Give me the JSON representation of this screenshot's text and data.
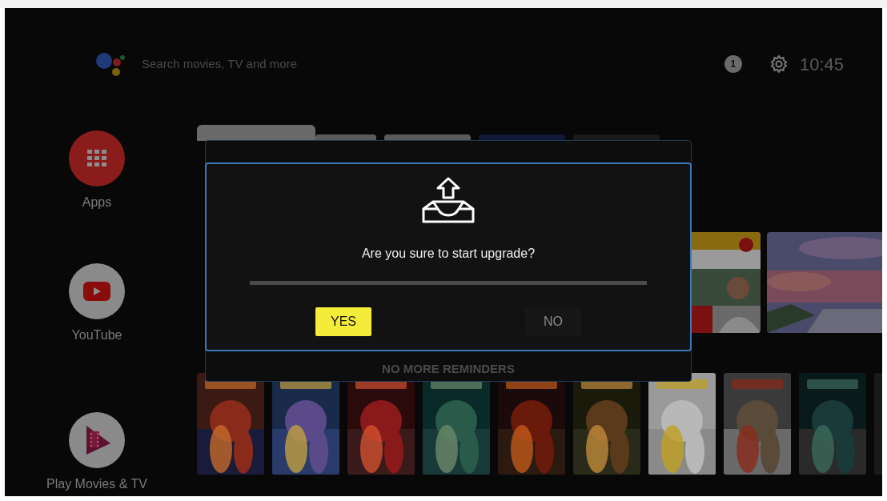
{
  "top_bar": {
    "search": {
      "placeholder": "Search movies, TV and more"
    },
    "notification_count": "1",
    "time": "10:45"
  },
  "apps": [
    {
      "label": "Apps",
      "kind": "apps"
    },
    {
      "label": "YouTube",
      "kind": "youtube"
    },
    {
      "label": "Play Movies & TV",
      "kind": "play"
    }
  ],
  "background_dialog": {
    "button": "NO MORE REMINDERS"
  },
  "dialog": {
    "message": "Are you sure to start upgrade?",
    "buttons": [
      {
        "label": "YES",
        "selected": true
      },
      {
        "label": "NO",
        "selected": false
      }
    ]
  }
}
